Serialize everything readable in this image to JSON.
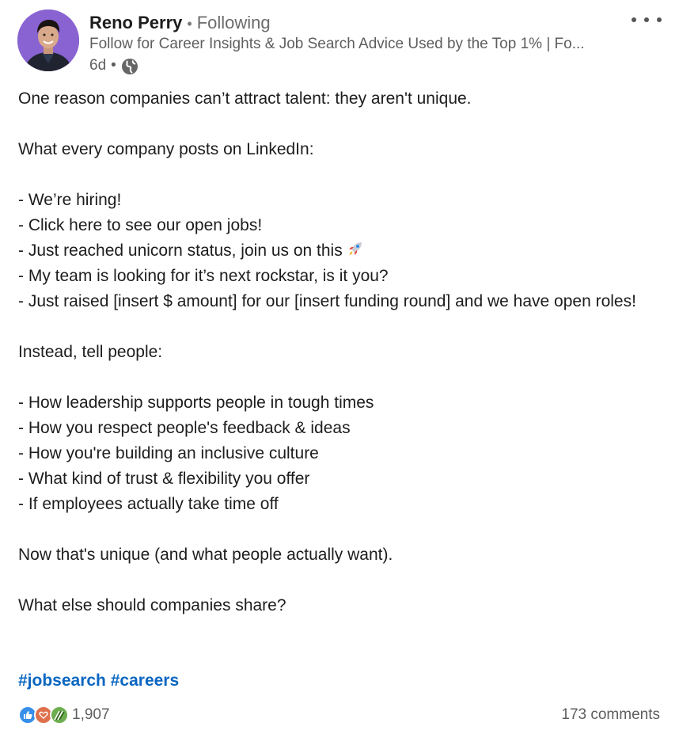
{
  "author": {
    "name": "Reno Perry",
    "separator": "•",
    "follow_state": "Following",
    "headline": "Follow for Career Insights & Job Search Advice Used by the Top 1% | Fo...",
    "posted_ago": "6d",
    "meta_separator": "•",
    "visibility_icon": "globe-icon"
  },
  "post": {
    "paragraphs": [
      "One reason companies can’t attract talent: they aren't unique.",
      "",
      "What every company posts on LinkedIn:",
      "",
      "- We’re hiring!",
      "- Click here to see our open jobs!",
      "- Just reached unicorn status, join us on this",
      "- My team is looking for it’s next rockstar, is it you?",
      "- Just raised [insert $ amount] for our [insert funding round] and we have open roles!",
      "",
      "Instead, tell people:",
      "",
      "- How leadership supports people in tough times",
      "- How you respect people's feedback & ideas",
      "- How you're building an inclusive culture",
      "- What kind of trust & flexibility you offer",
      "- If employees actually take time off",
      "",
      "Now that's unique (and what people actually want).",
      "",
      "What else should companies share?"
    ],
    "hashtags": [
      "#jobsearch",
      "#careers"
    ]
  },
  "social": {
    "reaction_icons": [
      "like-icon",
      "love-icon",
      "support-icon"
    ],
    "reaction_count": "1,907",
    "comments": "173 comments"
  },
  "colors": {
    "hashtag": "#0a66c2",
    "avatar_bg": "#8a63d2",
    "like": "#378fe9",
    "love": "#df704d",
    "support": "#6dae4f"
  }
}
